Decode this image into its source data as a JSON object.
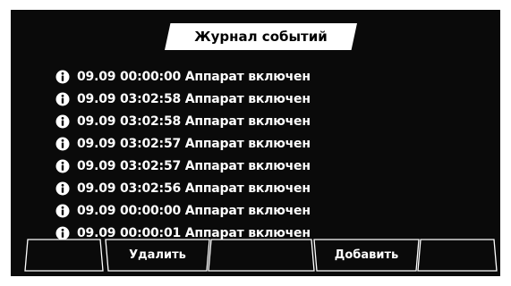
{
  "header": {
    "title": "Журнал событий"
  },
  "events": [
    {
      "icon": "info-icon",
      "date": "09.09",
      "time": "00:00:00",
      "message": "Аппарат включен"
    },
    {
      "icon": "info-icon",
      "date": "09.09",
      "time": "03:02:58",
      "message": "Аппарат включен"
    },
    {
      "icon": "info-icon",
      "date": "09.09",
      "time": "03:02:58",
      "message": "Аппарат включен"
    },
    {
      "icon": "info-icon",
      "date": "09.09",
      "time": "03:02:57",
      "message": "Аппарат включен"
    },
    {
      "icon": "info-icon",
      "date": "09.09",
      "time": "03:02:57",
      "message": "Аппарат включен"
    },
    {
      "icon": "info-icon",
      "date": "09.09",
      "time": "03:02:56",
      "message": "Аппарат включен"
    },
    {
      "icon": "info-icon",
      "date": "09.09",
      "time": "00:00:00",
      "message": "Аппарат включен"
    },
    {
      "icon": "info-icon",
      "date": "09.09",
      "time": "00:00:01",
      "message": "Аппарат включен"
    }
  ],
  "toolbar": {
    "buttons": [
      {
        "label": ""
      },
      {
        "label": "Удалить"
      },
      {
        "label": ""
      },
      {
        "label": "Добавить"
      },
      {
        "label": ""
      }
    ]
  },
  "colors": {
    "background": "#0a0a0a",
    "text": "#ffffff",
    "title_tab": "#ffffff"
  }
}
